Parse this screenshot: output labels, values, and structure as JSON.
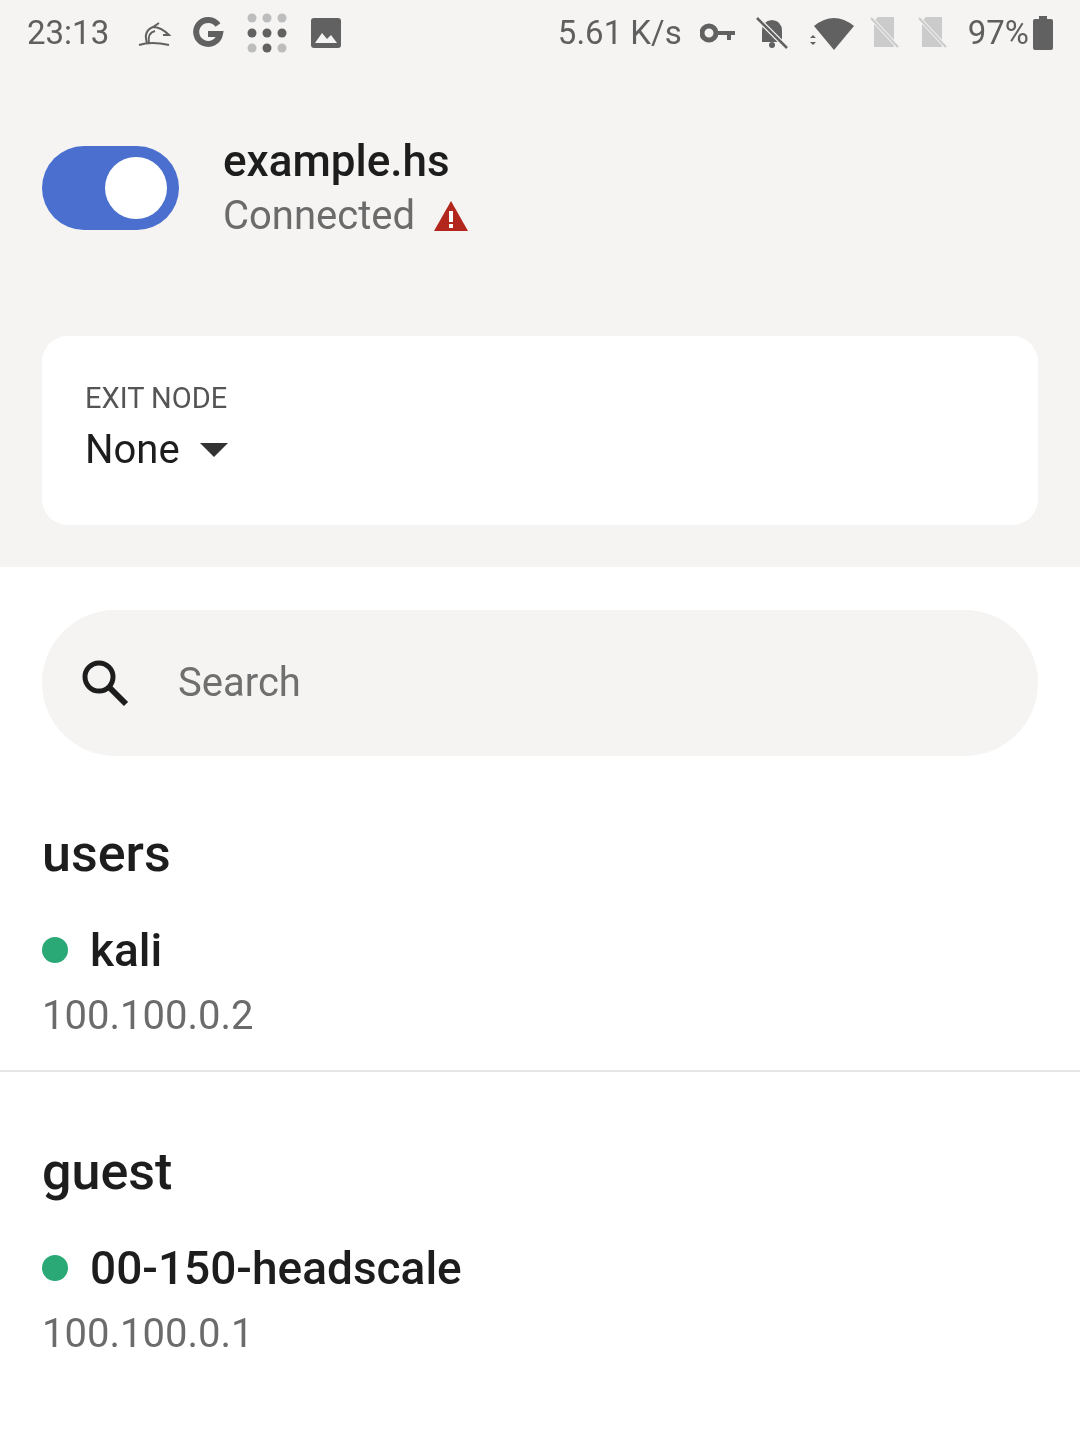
{
  "status_bar": {
    "time": "23:13",
    "network_speed": "5.61 K/s",
    "battery": "97%"
  },
  "connection": {
    "on": true,
    "server": "example.hs",
    "status": "Connected",
    "warning": true
  },
  "exit_node": {
    "label": "EXIT NODE",
    "value": "None"
  },
  "search": {
    "placeholder": "Search"
  },
  "groups": [
    {
      "name": "users",
      "devices": [
        {
          "name": "kali",
          "ip": "100.100.0.2",
          "color": "#2aa876"
        }
      ]
    },
    {
      "name": "guest",
      "devices": [
        {
          "name": "00-150-headscale",
          "ip": "100.100.0.1",
          "color": "#2aa876"
        }
      ]
    }
  ]
}
